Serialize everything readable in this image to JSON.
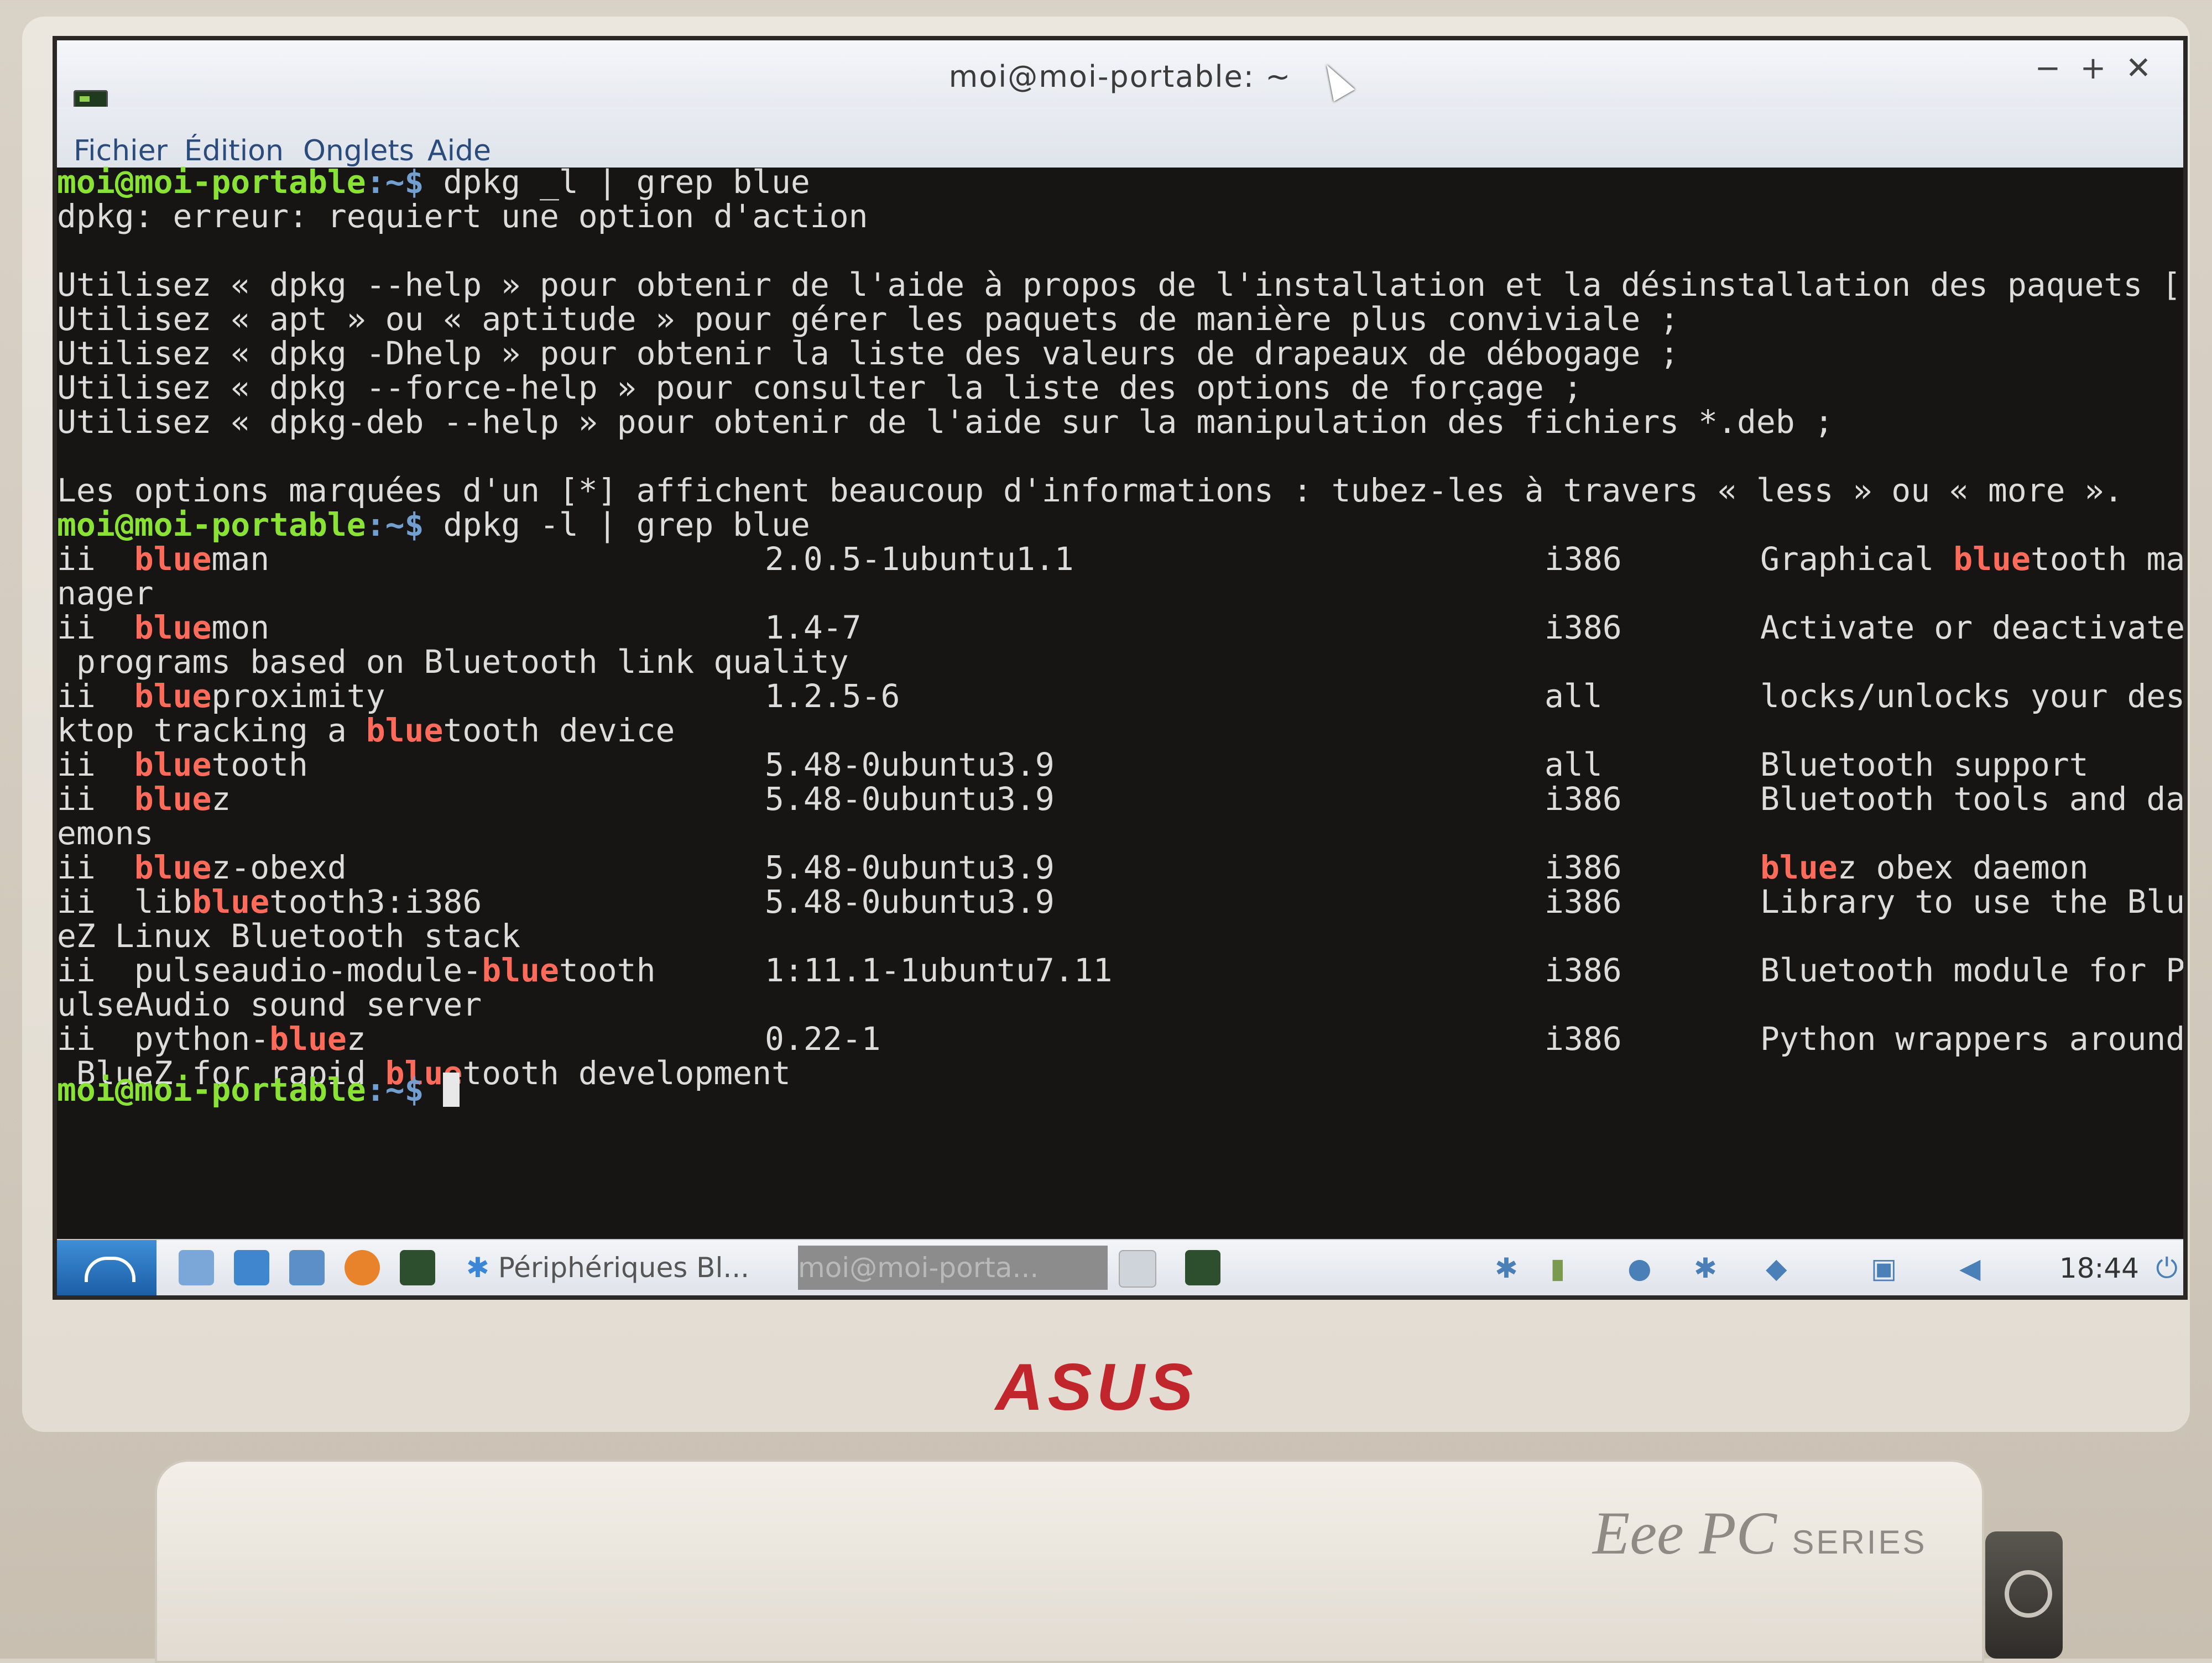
{
  "window": {
    "title": "moi@moi-portable: ~",
    "controls": [
      "−",
      "+",
      "✕"
    ]
  },
  "menu": [
    "Fichier",
    "Édition",
    "Onglets",
    "Aide"
  ],
  "prompt": {
    "user": "moi@moi-portable",
    "path": ":~$"
  },
  "terminal": {
    "cmd1": " dpkg _l | grep blue",
    "err": "dpkg: erreur: requiert une option d'action",
    "help": [
      "Utilisez « dpkg --help » pour obtenir de l'aide à propos de l'installation et la désinstallation des paquets [*] ;",
      "Utilisez « apt » ou « aptitude » pour gérer les paquets de manière plus conviviale ;",
      "Utilisez « dpkg -Dhelp » pour obtenir la liste des valeurs de drapeaux de débogage ;",
      "Utilisez « dpkg --force-help » pour consulter la liste des options de forçage ;",
      "Utilisez « dpkg-deb --help » pour obtenir de l'aide sur la manipulation des fichiers *.deb ;"
    ],
    "note": "Les options marquées d'un [*] affichent beaucoup d'informations : tubez-les à travers « less » ou « more ».",
    "cmd2": " dpkg -l | grep blue",
    "packages": [
      {
        "pre": "ii  ",
        "hl": "blue",
        "post": "man",
        "ver": "2.0.5-1ubuntu1.1",
        "arch": "i386",
        "desc_pre": "Graphical ",
        "desc_hl": "blue",
        "desc_post": "tooth ma",
        "wrap": "nager"
      },
      {
        "pre": "ii  ",
        "hl": "blue",
        "post": "mon",
        "ver": "1.4-7",
        "arch": "i386",
        "desc_pre": "Activate or deactivate",
        "desc_hl": "",
        "desc_post": "",
        "wrap": " programs based on Bluetooth link quality"
      },
      {
        "pre": "ii  ",
        "hl": "blue",
        "post": "proximity",
        "ver": "1.2.5-6",
        "arch": "all",
        "desc_pre": "locks/unlocks your des",
        "desc_hl": "",
        "desc_post": "",
        "wrap_pre": "ktop tracking a ",
        "wrap_hl": "blue",
        "wrap_post": "tooth device"
      },
      {
        "pre": "ii  ",
        "hl": "blue",
        "post": "tooth",
        "ver": "5.48-0ubuntu3.9",
        "arch": "all",
        "desc_pre": "Bluetooth support",
        "desc_hl": "",
        "desc_post": ""
      },
      {
        "pre": "ii  ",
        "hl": "blue",
        "post": "z",
        "ver": "5.48-0ubuntu3.9",
        "arch": "i386",
        "desc_pre": "Bluetooth tools and da",
        "desc_hl": "",
        "desc_post": "",
        "wrap": "emons"
      },
      {
        "pre": "ii  ",
        "hl": "blue",
        "post": "z-obexd",
        "ver": "5.48-0ubuntu3.9",
        "arch": "i386",
        "desc_pre": "",
        "desc_hl": "blue",
        "desc_post": "z obex daemon"
      },
      {
        "pre": "ii  lib",
        "hl": "blue",
        "post": "tooth3:i386",
        "ver": "5.48-0ubuntu3.9",
        "arch": "i386",
        "desc_pre": "Library to use the Blu",
        "desc_hl": "",
        "desc_post": "",
        "wrap": "eZ Linux Bluetooth stack"
      },
      {
        "pre": "ii  pulseaudio-module-",
        "hl": "blue",
        "post": "tooth",
        "ver": "1:11.1-1ubuntu7.11",
        "arch": "i386",
        "desc_pre": "Bluetooth module for P",
        "desc_hl": "",
        "desc_post": "",
        "wrap": "ulseAudio sound server"
      },
      {
        "pre": "ii  python-",
        "hl": "blue",
        "post": "z",
        "ver": "0.22-1",
        "arch": "i386",
        "desc_pre": "Python wrappers around",
        "desc_hl": "",
        "desc_post": "",
        "wrap_pre": " BlueZ for rapid ",
        "wrap_hl": "blue",
        "wrap_post": "tooth development"
      }
    ]
  },
  "taskbar": {
    "task1": "Périphériques Bl...",
    "task2": "moi@moi-porta...",
    "clock": "18:44"
  },
  "hardware": {
    "brand": "ASUS",
    "model": "Eee PC",
    "series": "SERIES"
  },
  "colors": {
    "prompt_user": "#8ae234",
    "prompt_path": "#729fcf",
    "highlight": "#ff6b5a",
    "terminal_bg": "#171513",
    "brand_red": "#c0262b"
  }
}
